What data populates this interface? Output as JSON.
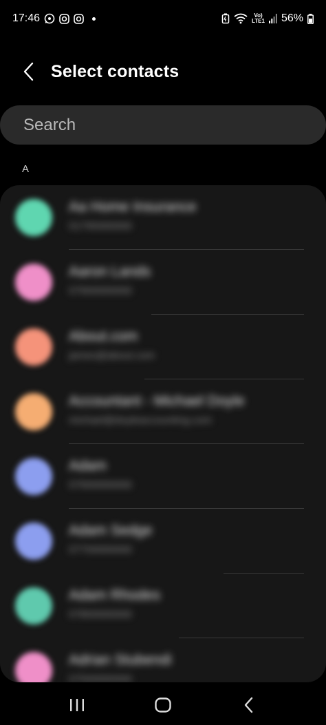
{
  "status_bar": {
    "time": "17:46",
    "battery": "56%",
    "network_top": "Vo)",
    "network_bottom": "LTE1"
  },
  "header": {
    "title": "Select contacts"
  },
  "search": {
    "placeholder": "Search"
  },
  "section": {
    "letter": "A"
  },
  "contacts": [
    {
      "name": "Aa Home Insurance",
      "sub": "01795000000",
      "color": "#5fd6b0"
    },
    {
      "name": "Aaron Lands",
      "sub": "07900000000",
      "color": "#ef8fc8"
    },
    {
      "name": "About.com",
      "sub": "james@about.com",
      "color": "#f5937a"
    },
    {
      "name": "Accountant - Michael Doyle",
      "sub": "michael@doyleaccounting.com",
      "color": "#f5ad72"
    },
    {
      "name": "Adam",
      "sub": "07900000000",
      "color": "#8c9eef"
    },
    {
      "name": "Adam Sedge",
      "sub": "07700000000",
      "color": "#8c9eef"
    },
    {
      "name": "Adam Rhodes",
      "sub": "07800000000",
      "color": "#5fc9ad"
    },
    {
      "name": "Adrian Stubendi",
      "sub": "07500000000",
      "color": "#ef8fc8"
    }
  ],
  "colors": {
    "background": "#000000",
    "card": "#171717",
    "search_bg": "#2a2a2a"
  }
}
